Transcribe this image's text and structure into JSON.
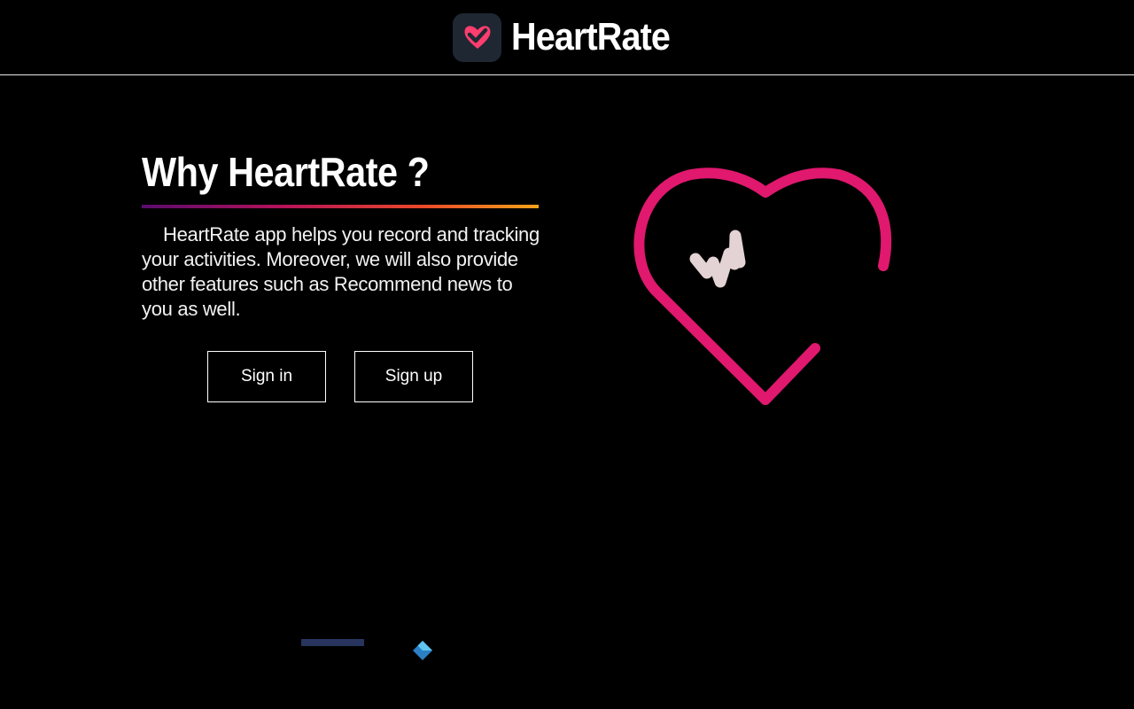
{
  "header": {
    "app_name": "HeartRate",
    "logo_icon": "heart-check-icon"
  },
  "intro": {
    "title": "Why HeartRate ?",
    "description": "HeartRate app helps you record and tracking your activities. Moreover, we will also provide other features such as Recommend news to you as well."
  },
  "actions": {
    "sign_in_label": "Sign in",
    "sign_up_label": "Sign up"
  },
  "illustration": {
    "icon": "heart-pulse-icon"
  },
  "colors": {
    "background": "#000000",
    "accent_pink": "#e0186e",
    "pulse_line": "#e3d3d4",
    "logo_tile": "#1f2733",
    "logo_heart": "#ff3d6e"
  }
}
